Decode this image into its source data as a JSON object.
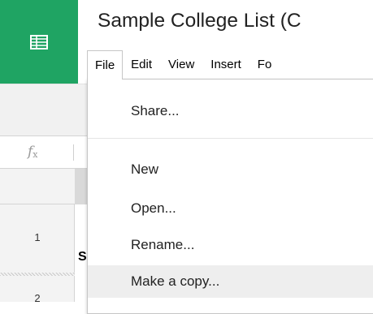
{
  "app": {
    "logo_icon": "sheets-grid-icon",
    "brand_color": "#1fa463"
  },
  "document": {
    "title": "Sample College List (C"
  },
  "menubar": {
    "items": [
      {
        "label": "File",
        "active": true
      },
      {
        "label": "Edit"
      },
      {
        "label": "View"
      },
      {
        "label": "Insert"
      },
      {
        "label": "Fo"
      }
    ]
  },
  "formula_bar": {
    "icon": "function-fx-icon",
    "fx_f": "f",
    "fx_x": "x"
  },
  "grid": {
    "rows": [
      "1",
      "2"
    ],
    "cell_a1_partial": "S"
  },
  "file_menu": {
    "items": [
      {
        "label": "Share..."
      },
      {
        "label": "New"
      },
      {
        "label": "Open..."
      },
      {
        "label": "Rename..."
      },
      {
        "label": "Make a copy...",
        "highlighted": true
      }
    ]
  }
}
